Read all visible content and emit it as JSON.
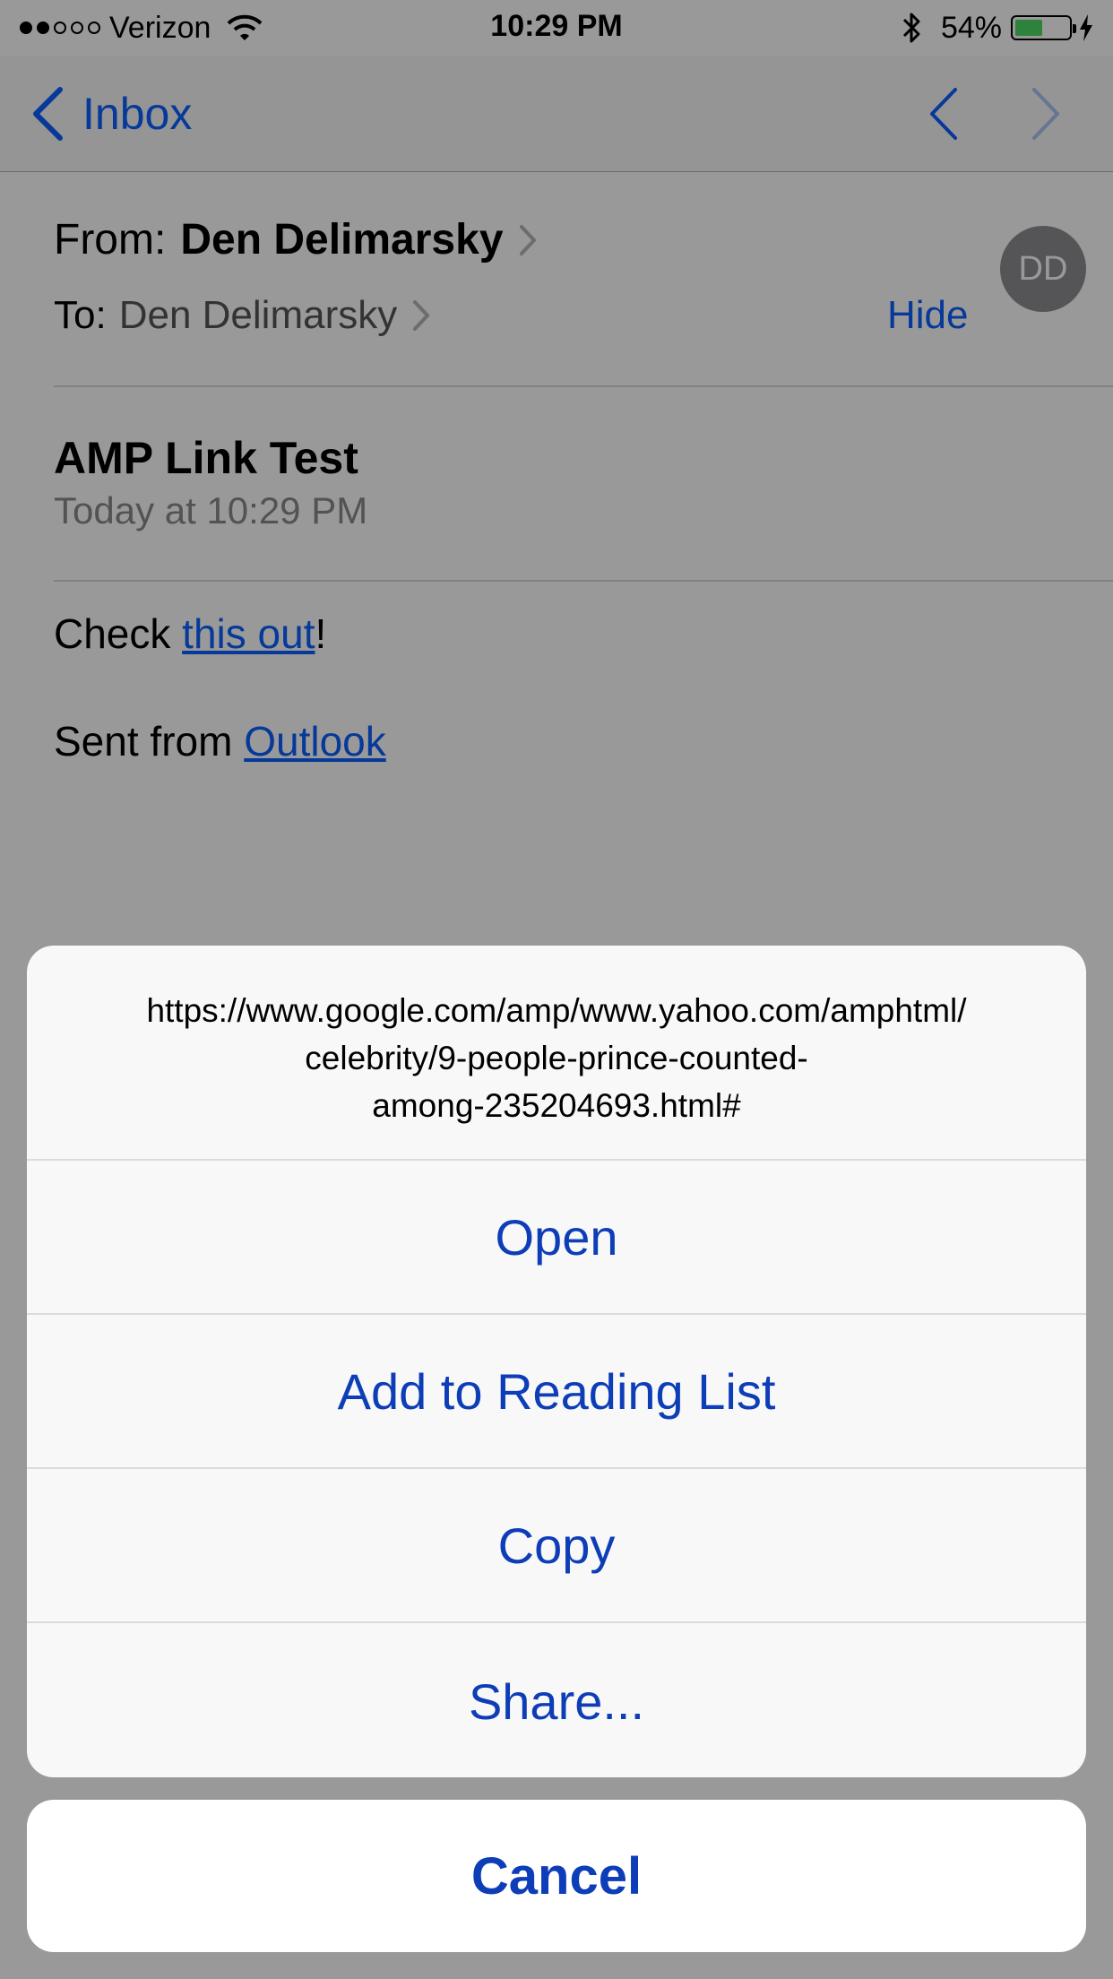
{
  "status_bar": {
    "carrier": "Verizon",
    "signal_bars_filled": 2,
    "signal_bars_total": 5,
    "time": "10:29 PM",
    "battery_percent": "54%",
    "battery_fill_fraction": 0.54,
    "icons": [
      "wifi-icon",
      "bluetooth-icon",
      "battery-icon",
      "charging-bolt-icon"
    ]
  },
  "nav": {
    "back_label": "Inbox",
    "icons": [
      "chevron-left-icon",
      "previous-message-icon",
      "next-message-icon"
    ]
  },
  "email": {
    "from_label": "From:",
    "from_name": "Den Delimarsky",
    "to_label": "To:",
    "to_name": "Den Delimarsky",
    "hide_label": "Hide",
    "avatar_initials": "DD",
    "subject": "AMP Link Test",
    "date": "Today at 10:29 PM",
    "body_prefix": "Check ",
    "body_link": "this out",
    "body_suffix": "!",
    "signature_prefix": "Sent from ",
    "signature_link": "Outlook"
  },
  "action_sheet": {
    "url_line1": "https://www.google.com/amp/www.yahoo.com/amphtml/",
    "url_line2": "celebrity/9-people-prince-counted-",
    "url_line3": "among-235204693.html#",
    "open_label": "Open",
    "reading_list_label": "Add to Reading List",
    "copy_label": "Copy",
    "share_label": "Share...",
    "cancel_label": "Cancel"
  },
  "colors": {
    "accent": "#0a5fff",
    "sheet_button_text": "#0d3db7",
    "battery_green": "#4cd964"
  }
}
